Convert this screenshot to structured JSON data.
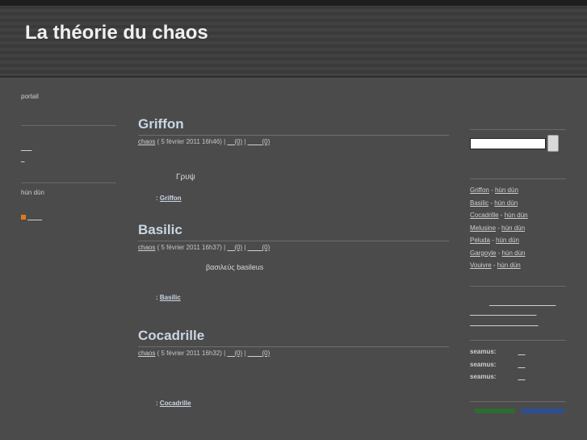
{
  "site": {
    "title": "La théorie du chaos"
  },
  "left": {
    "portal": "portail",
    "links": [
      "___",
      "_"
    ],
    "author": "hùn dùn",
    "feed_link": "____"
  },
  "posts": [
    {
      "title": "Griffon",
      "meta": {
        "author": "chaos",
        "date": " ( 5 février 2011 16h46) | ",
        "comments": "__(0)",
        "sep": " | ",
        "trackbacks": "____(0)"
      },
      "body": "Γρυψ",
      "category_prefix": ": ",
      "category": "Griffon"
    },
    {
      "title": "Basilic",
      "meta": {
        "author": "chaos",
        "date": " ( 5 février 2011 16h37) | ",
        "comments": "__(0)",
        "sep": " | ",
        "trackbacks": "____(0)"
      },
      "body": "βασιλεύς basileus",
      "category_prefix": ": ",
      "category": "Basilic"
    },
    {
      "title": "Cocadrille",
      "meta": {
        "author": "chaos",
        "date": " ( 5 février 2011 16h32) | ",
        "comments": "__(0)",
        "sep": " | ",
        "trackbacks": "____(0)"
      },
      "body": "",
      "category_prefix": ": ",
      "category": "Cocadrille"
    }
  ],
  "right": {
    "search_placeholder": "",
    "recent": [
      {
        "title": "Griffon",
        "author": "hùn dùn"
      },
      {
        "title": "Basilic",
        "author": "hùn dùn"
      },
      {
        "title": "Cocadrille",
        "author": "hùn dùn"
      },
      {
        "title": "Melusine",
        "author": "hùn dùn"
      },
      {
        "title": "Peluda",
        "author": "hùn dùn"
      },
      {
        "title": "Gargoyle",
        "author": "hùn dùn"
      },
      {
        "title": "Vouivre",
        "author": "hùn dùn"
      }
    ],
    "separator": " - ",
    "tags": [
      "____ __ __ ____ ___ _",
      "__ ___ ____ __ __ ___",
      "__ ___ ___ __ __ __ __"
    ],
    "comments": [
      {
        "author": "seamus:",
        "link": "__"
      },
      {
        "author": "seamus:",
        "link": "__"
      },
      {
        "author": "seamus:",
        "link": "__"
      }
    ]
  },
  "colors": {
    "background": "#4b4b4b",
    "header": "#3a3a3a",
    "title_link": "#c9d6e3"
  }
}
